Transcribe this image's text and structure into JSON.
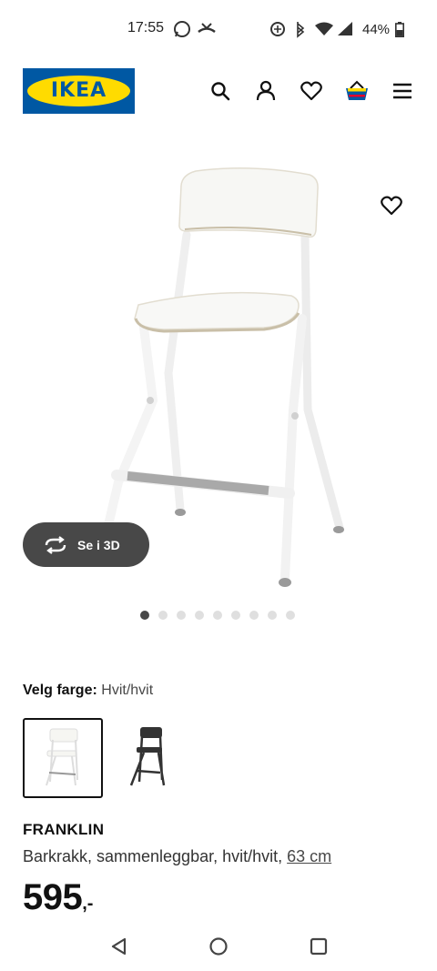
{
  "status_bar": {
    "time": "17:55",
    "battery": "44%",
    "icons": [
      "whatsapp-icon",
      "missed-call-icon",
      "data-saver-icon",
      "bluetooth-icon",
      "wifi-icon",
      "signal-icon",
      "battery-icon"
    ]
  },
  "header": {
    "logo_text": "IKEA",
    "icons": [
      "search-icon",
      "user-icon",
      "heart-icon",
      "basket-icon",
      "menu-icon"
    ]
  },
  "product": {
    "view3d_label": "Se i 3D",
    "carousel": {
      "count": 9,
      "active_index": 0
    },
    "color_label": "Velg farge:",
    "color_value": "Hvit/hvit",
    "swatches": [
      {
        "name": "white",
        "selected": true
      },
      {
        "name": "black",
        "selected": false
      }
    ],
    "name": "FRANKLIN",
    "description": "Barkrakk, sammenleggbar, hvit/hvit, ",
    "size_link": "63 cm",
    "price": "595",
    "price_suffix": ",-"
  },
  "colors": {
    "ikea_blue": "#0058a3",
    "ikea_yellow": "#ffdb00",
    "dark_grey": "#484848"
  }
}
